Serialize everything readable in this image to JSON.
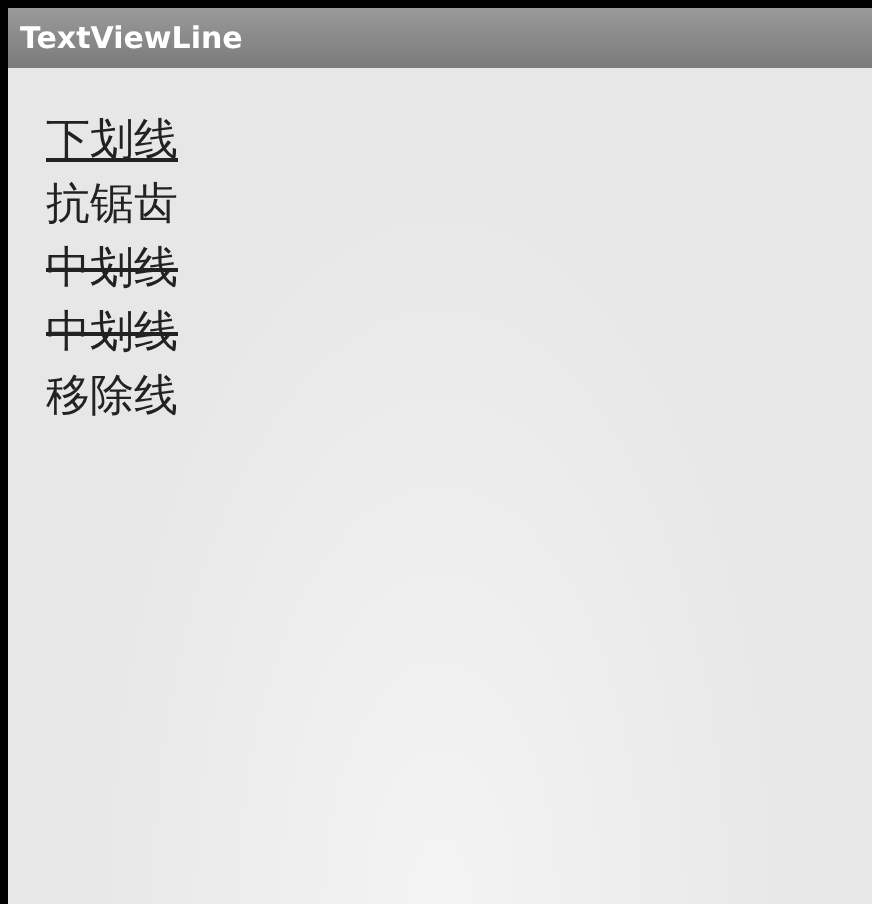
{
  "window": {
    "title": "TextViewLine"
  },
  "lines": [
    {
      "text": "下划线",
      "kind": "underline"
    },
    {
      "text": "抗锯齿",
      "kind": "plain"
    },
    {
      "text": "中划线",
      "kind": "strike"
    },
    {
      "text": "中划线",
      "kind": "strike"
    },
    {
      "text": "移除线",
      "kind": "plain"
    }
  ]
}
